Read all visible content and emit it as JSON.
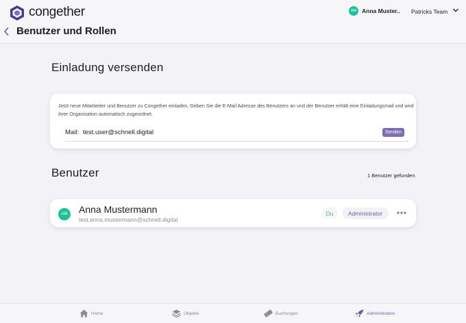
{
  "brand": {
    "name": "congether"
  },
  "header": {
    "user": {
      "initials": "AM",
      "name": "Anna Muster..."
    },
    "team": "Patricks Team",
    "page_title": "Benutzer und Rollen"
  },
  "invite": {
    "heading": "Einladung versenden",
    "description": "Jetzt neue Mitarbeiter und Benutzer zu Congether einladen. Geben Sie die E-Mail Adresse des Benutzers an und der Benutzer erhält eine Einladungsmail und wird ihrer Organisation automatisch zugeordnet.",
    "mail_label": "Mail:",
    "mail_value": "test.user@schnell.digital",
    "send_label": "Senden"
  },
  "users": {
    "heading": "Benutzer",
    "count_text": "1 Benutzer gefunden",
    "rows": [
      {
        "initials": "AM",
        "name": "Anna Mustermann",
        "email": "test.anna.mustermann@schnell.digital",
        "self_badge": "Du",
        "role": "Administrator"
      }
    ]
  },
  "bottom_nav": {
    "items": [
      {
        "label": "Home",
        "icon": "home-icon"
      },
      {
        "label": "Objekte",
        "icon": "layers-icon"
      },
      {
        "label": "Buchungen",
        "icon": "ticket-icon"
      },
      {
        "label": "Administration",
        "icon": "rocket-icon",
        "active": true
      }
    ]
  },
  "colors": {
    "accent": "#6c5fa8",
    "avatar": "#1fbf9b",
    "self_badge": "#43b47f",
    "background": "#f3f3f7"
  }
}
